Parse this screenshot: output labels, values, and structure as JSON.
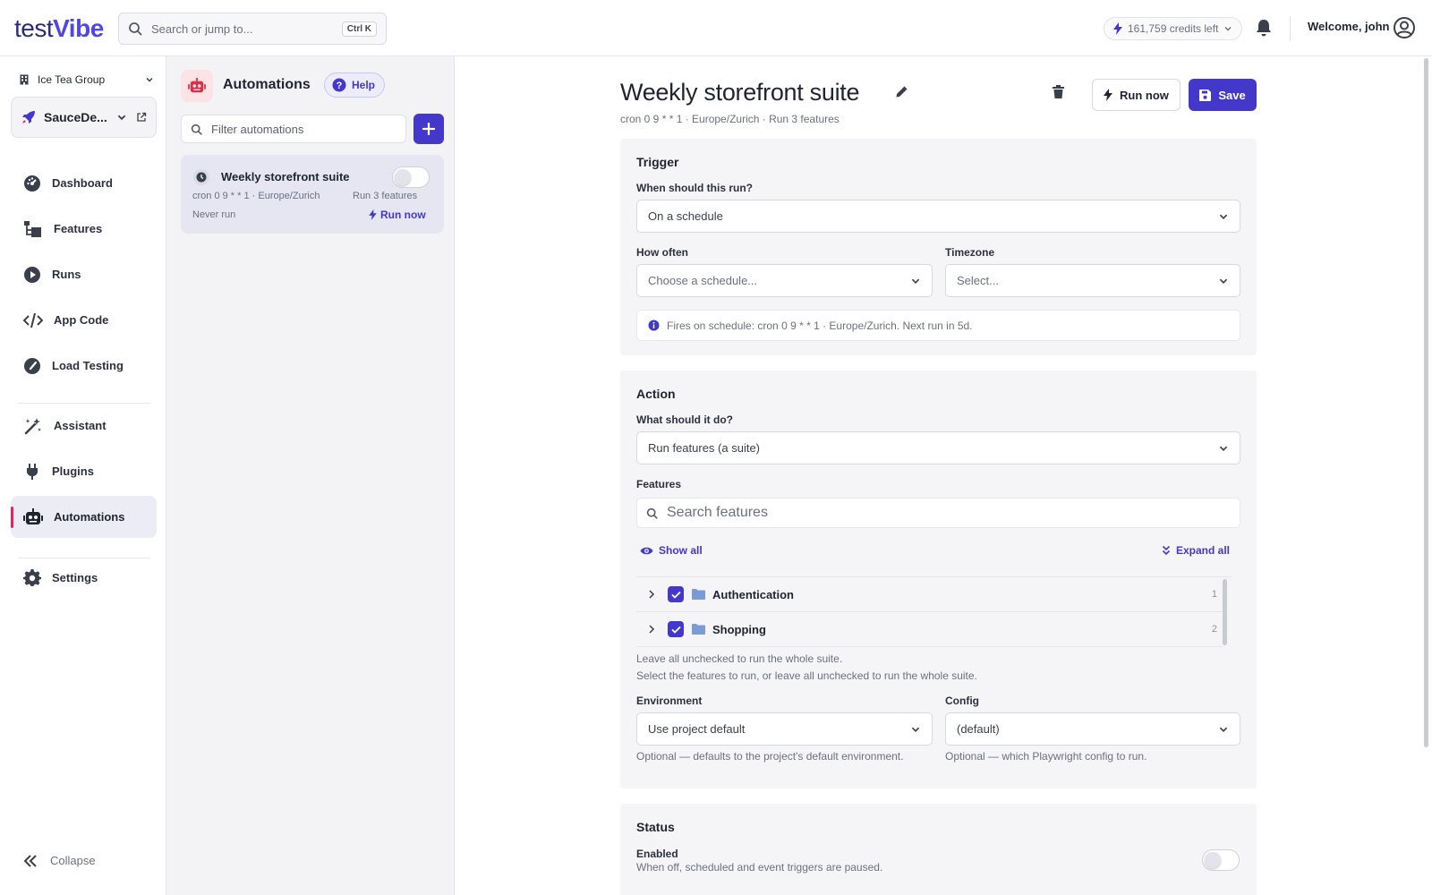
{
  "header": {
    "logo_text_a": "test",
    "logo_text_b": "Vibe",
    "search_placeholder": "Search or jump to...",
    "search_shortcut": "Ctrl K",
    "credits": "161,759 credits left",
    "welcome": "Welcome, john"
  },
  "sidebar": {
    "org": "Ice Tea Group",
    "project": "SauceDe...",
    "items": [
      {
        "label": "Dashboard",
        "icon": "dashboard-icon"
      },
      {
        "label": "Features",
        "icon": "features-icon"
      },
      {
        "label": "Runs",
        "icon": "play-icon"
      },
      {
        "label": "App Code",
        "icon": "code-icon"
      },
      {
        "label": "Load Testing",
        "icon": "gauge-icon"
      },
      {
        "label": "Assistant",
        "icon": "magic-wand-icon"
      },
      {
        "label": "Plugins",
        "icon": "plug-icon"
      },
      {
        "label": "Automations",
        "icon": "robot-icon",
        "active": true
      },
      {
        "label": "Settings",
        "icon": "gear-icon"
      }
    ],
    "collapse": "Collapse"
  },
  "list": {
    "title": "Automations",
    "help": "Help",
    "filter_placeholder": "Filter automations",
    "card": {
      "name": "Weekly storefront suite",
      "meta": "cron 0 9 * * 1 · Europe/Zurich",
      "action": "Run 3 features",
      "last_run": "Never run",
      "run_now": "Run now",
      "enabled": false
    }
  },
  "main": {
    "title": "Weekly storefront suite",
    "subtitle": "cron 0 9 * * 1 · Europe/Zurich · Run 3 features",
    "run_now": "Run now",
    "save": "Save",
    "trigger": {
      "title": "Trigger",
      "when_label": "When should this run?",
      "when_value": "On a schedule",
      "how_often_label": "How often",
      "how_often_placeholder": "Choose a schedule...",
      "timezone_label": "Timezone",
      "timezone_placeholder": "Select...",
      "info": "Fires on schedule: cron 0 9 * * 1 · Europe/Zurich. Next run in 5d."
    },
    "action": {
      "title": "Action",
      "what_label": "What should it do?",
      "what_value": "Run features (a suite)",
      "features_label": "Features",
      "features_search_placeholder": "Search features",
      "show_all": "Show all",
      "expand_all": "Expand all",
      "tree": [
        {
          "name": "Authentication",
          "count": "1",
          "checked": true
        },
        {
          "name": "Shopping",
          "count": "2",
          "checked": true
        }
      ],
      "hint1": "Leave all unchecked to run the whole suite.",
      "hint2": "Select the features to run, or leave all unchecked to run the whole suite.",
      "env_label": "Environment",
      "env_value": "Use project default",
      "env_hint": "Optional — defaults to the project's default environment.",
      "config_label": "Config",
      "config_value": "(default)",
      "config_hint": "Optional — which Playwright config to run."
    },
    "status": {
      "title": "Status",
      "enabled_label": "Enabled",
      "enabled_hint": "When off, scheduled and event triggers are paused.",
      "enabled": false
    }
  },
  "colors": {
    "accent": "#4338ca",
    "active_marker": "#e0245e"
  }
}
